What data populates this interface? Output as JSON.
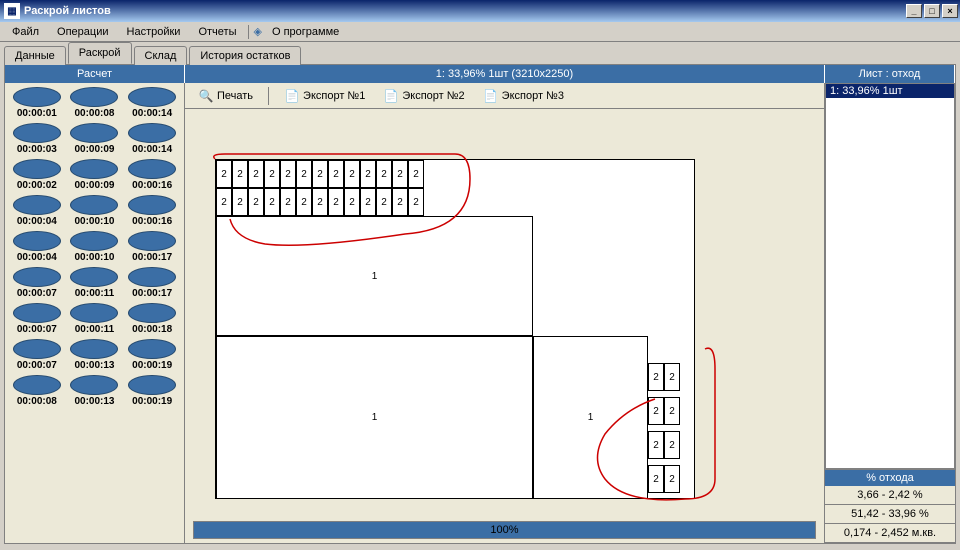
{
  "window": {
    "title": "Раскрой листов"
  },
  "menu": {
    "file": "Файл",
    "operations": "Операции",
    "settings": "Настройки",
    "reports": "Отчеты",
    "about": "О программе"
  },
  "tabs": {
    "data": "Данные",
    "layout": "Раскрой",
    "stock": "Склад",
    "history": "История остатков"
  },
  "header": {
    "calc": "Расчет",
    "info": "1:  33,96% 1шт (3210x2250)",
    "list": "Лист : отход"
  },
  "toolbar": {
    "print": "Печать",
    "export1": "Экспорт №1",
    "export2": "Экспорт №2",
    "export3": "Экспорт №3"
  },
  "pills": [
    [
      "00:00:01",
      "00:00:08",
      "00:00:14"
    ],
    [
      "00:00:03",
      "00:00:09",
      "00:00:14"
    ],
    [
      "00:00:02",
      "00:00:09",
      "00:00:16"
    ],
    [
      "00:00:04",
      "00:00:10",
      "00:00:16"
    ],
    [
      "00:00:04",
      "00:00:10",
      "00:00:17"
    ],
    [
      "00:00:07",
      "00:00:11",
      "00:00:17"
    ],
    [
      "00:00:07",
      "00:00:11",
      "00:00:18"
    ],
    [
      "00:00:07",
      "00:00:13",
      "00:00:19"
    ],
    [
      "00:00:08",
      "00:00:13",
      "00:00:19"
    ]
  ],
  "cells": {
    "small": "2",
    "big": "1"
  },
  "progress": {
    "text": "100%"
  },
  "list": {
    "item1": "1:  33,96% 1шт"
  },
  "stats": {
    "header": "% отхода",
    "row1": "3,66 - 2,42 %",
    "row2": "51,42 - 33,96 %",
    "row3": "0,174 - 2,452 м.кв."
  }
}
